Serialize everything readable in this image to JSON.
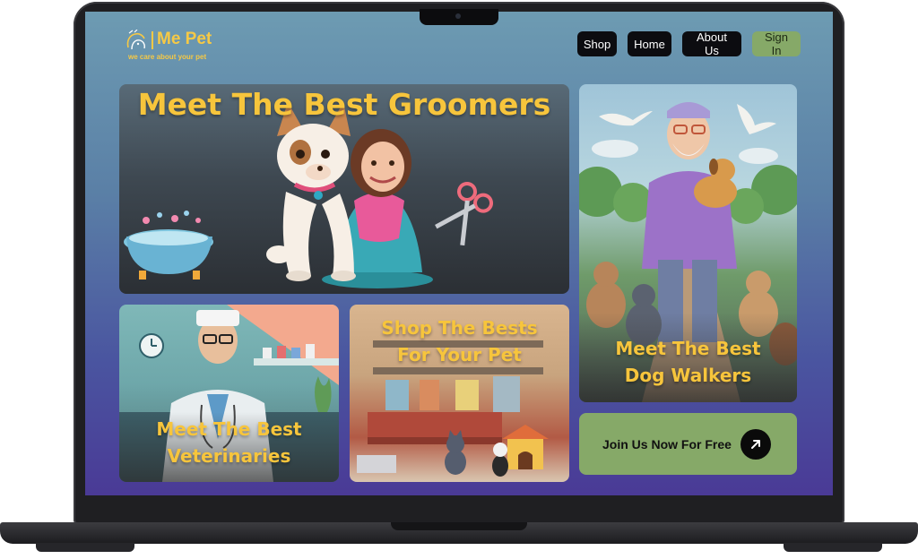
{
  "brand": {
    "name": "Me Pet",
    "tagline": "we care about your pet",
    "accent": "#f6c945"
  },
  "nav": {
    "items": [
      "Shop",
      "Home",
      "About Us"
    ],
    "signin_label": "Sign In",
    "signin_color": "#86a968"
  },
  "cards": {
    "groomers_title": "Meet The Best Groomers",
    "walkers_title_1": "Meet The Best",
    "walkers_title_2": "Dog Walkers",
    "vets_title_1": "Meet The Best",
    "vets_title_2": "Veterinaries",
    "shop_title_1": "Shop The Bests",
    "shop_title_2": "For Your Pet"
  },
  "cta": {
    "label": "Join Us Now For Free",
    "icon": "arrow-up-right-icon"
  }
}
